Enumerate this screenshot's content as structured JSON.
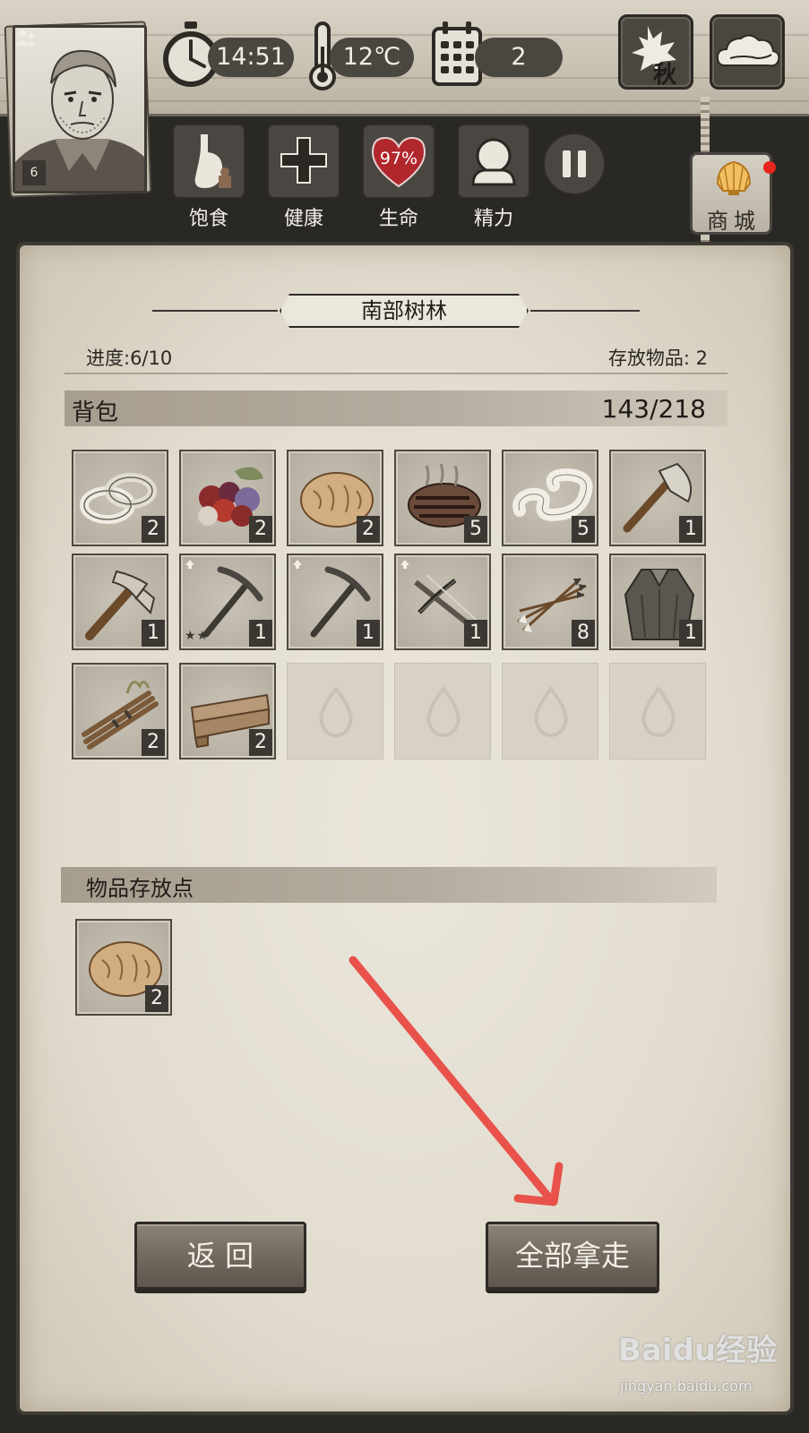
{
  "header": {
    "time": "14:51",
    "temperature": "12℃",
    "day": "2",
    "season_label": "秋",
    "weather_icon": "cloud-icon",
    "character_level": "6"
  },
  "status": {
    "items": [
      {
        "label": "饱食",
        "icon": "stomach-icon"
      },
      {
        "label": "健康",
        "icon": "plus-cross-icon"
      },
      {
        "label": "生命",
        "icon": "heart-icon",
        "value": "97%"
      },
      {
        "label": "精力",
        "icon": "head-silhouette-icon"
      }
    ],
    "pause_icon": "pause-icon"
  },
  "shop": {
    "label": "商城",
    "icon": "shell-icon",
    "has_notification": true
  },
  "location": {
    "title": "南部树林",
    "progress": "进度:6/10",
    "stored_items": "存放物品: 2"
  },
  "backpack": {
    "title": "背包",
    "capacity": "143/218",
    "slots": [
      {
        "icon": "rope-coil-icon",
        "qty": "2"
      },
      {
        "icon": "berries-icon",
        "qty": "2"
      },
      {
        "icon": "bread-icon",
        "qty": "2"
      },
      {
        "icon": "grilled-meat-icon",
        "qty": "5"
      },
      {
        "icon": "cloth-strip-icon",
        "qty": "5"
      },
      {
        "icon": "axe-icon",
        "qty": "1"
      },
      {
        "icon": "hatchet-icon",
        "qty": "1"
      },
      {
        "icon": "pickaxe-icon",
        "qty": "1",
        "upgrade": true,
        "stars": "★★"
      },
      {
        "icon": "pickaxe-icon",
        "qty": "1",
        "upgrade": true
      },
      {
        "icon": "crossbow-icon",
        "qty": "1",
        "upgrade": true
      },
      {
        "icon": "arrows-icon",
        "qty": "8"
      },
      {
        "icon": "cloak-icon",
        "qty": "1"
      },
      {
        "icon": "sticks-bundle-icon",
        "qty": "2"
      },
      {
        "icon": "wood-planks-icon",
        "qty": "2"
      }
    ],
    "empty_slots": 4
  },
  "storage": {
    "title": "物品存放点",
    "slots": [
      {
        "icon": "bread-icon",
        "qty": "2"
      }
    ]
  },
  "buttons": {
    "back": "返 回",
    "take_all": "全部拿走"
  },
  "watermark": {
    "brand": "Baidu经验",
    "url": "jingyan.baidu.com"
  },
  "colors": {
    "panel": "#e2dccf",
    "dark": "#4a4640",
    "annotation_arrow": "#e8524a",
    "notification": "#e8251c"
  }
}
